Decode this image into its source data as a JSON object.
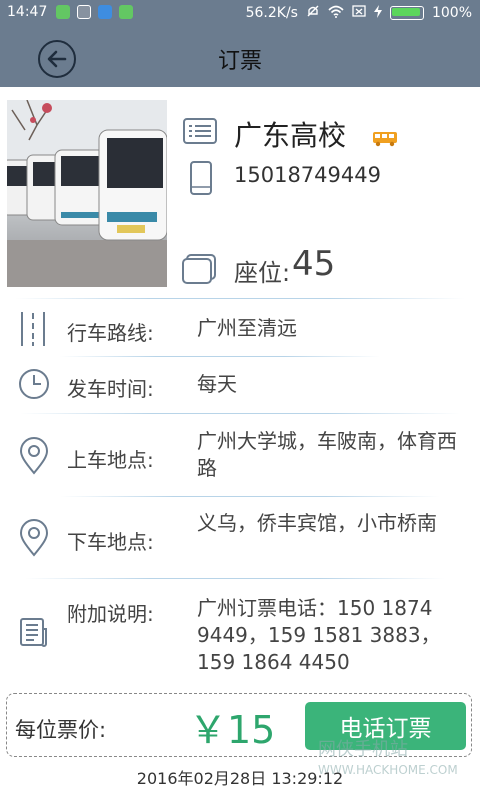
{
  "status_bar": {
    "time": "14:47",
    "network_speed": "56.2K/s",
    "battery": "100%"
  },
  "header": {
    "title": "订票",
    "back_icon": "back-arrow-icon"
  },
  "company": {
    "name": "广东高校",
    "phone": "15018749449",
    "seat_label": "座位:",
    "seat_count": "45"
  },
  "details": {
    "route": {
      "label": "行车路线:",
      "value": "广州至清远"
    },
    "departure": {
      "label": "发车时间:",
      "value": "每天"
    },
    "pickup": {
      "label": "上车地点:",
      "value": "广州大学城，车陂南，体育西路"
    },
    "dropoff": {
      "label": "下车地点:",
      "value": "义乌，侨丰宾馆，小市桥南"
    },
    "notes": {
      "label": "附加说明:",
      "value": "广州订票电话：150 1874 9449，159 1581 3883，159 1864 4450"
    }
  },
  "footer": {
    "price_label": "每位票价:",
    "price": "￥15",
    "call_button": "电话订票",
    "timestamp": "2016年02月28日  13:29:12"
  },
  "watermark": {
    "name": "网侠手机站",
    "url": "WWW.HACKHOME.COM"
  },
  "colors": {
    "header_bg": "#6b7c8f",
    "accent_green": "#3bb47a",
    "price_green": "#2ea66d"
  }
}
